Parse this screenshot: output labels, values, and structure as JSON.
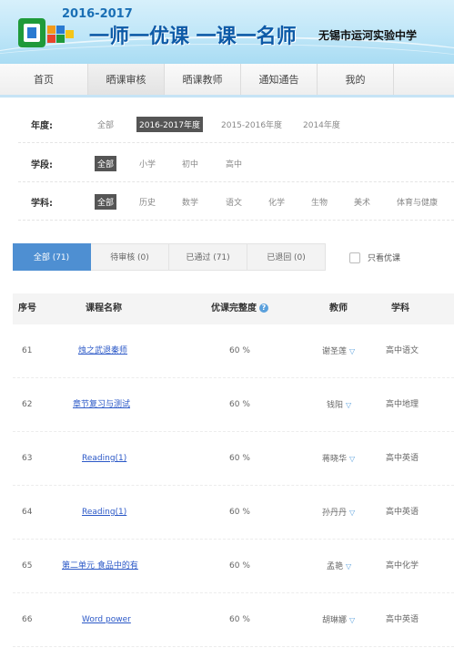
{
  "banner": {
    "year": "2016-2017",
    "slogan": "一师一优课 一课一名师",
    "school": "无锡市运河实验中学"
  },
  "nav": {
    "items": [
      {
        "label": "首页",
        "active": false
      },
      {
        "label": "晒课审核",
        "active": true
      },
      {
        "label": "晒课教师",
        "active": false
      },
      {
        "label": "通知通告",
        "active": false
      },
      {
        "label": "我的",
        "active": false
      }
    ]
  },
  "filters": {
    "year": {
      "label": "年度:",
      "options": [
        "全部",
        "2016-2017年度",
        "2015-2016年度",
        "2014年度"
      ],
      "selected": "2016-2017年度"
    },
    "level": {
      "label": "学段:",
      "options": [
        "全部",
        "小学",
        "初中",
        "高中"
      ],
      "selected": "全部"
    },
    "subject": {
      "label": "学科:",
      "options": [
        "全部",
        "历史",
        "数学",
        "语文",
        "化学",
        "生物",
        "美术",
        "体育与健康"
      ],
      "selected": "全部"
    }
  },
  "tabs": [
    {
      "label": "全部 (71)",
      "active": true
    },
    {
      "label": "待审核 (0)",
      "active": false
    },
    {
      "label": "已通过 (71)",
      "active": false
    },
    {
      "label": "已退回 (0)",
      "active": false
    }
  ],
  "only_good": {
    "label": "只看优课",
    "checked": false
  },
  "table": {
    "headers": {
      "seq": "序号",
      "course": "课程名称",
      "completeness": "优课完整度",
      "teacher": "教师",
      "subject": "学科"
    },
    "rows": [
      {
        "seq": "61",
        "course": "烛之武退秦师",
        "completeness": "60 %",
        "teacher": "谢圣莲",
        "subject": "高中语文"
      },
      {
        "seq": "62",
        "course": "章节复习与测试",
        "completeness": "60 %",
        "teacher": "钱阳",
        "subject": "高中地理"
      },
      {
        "seq": "63",
        "course": "Reading(1)",
        "completeness": "60 %",
        "teacher": "蒋晓华",
        "subject": "高中英语"
      },
      {
        "seq": "64",
        "course": "Reading(1)",
        "completeness": "60 %",
        "teacher": "孙丹丹",
        "subject": "高中英语"
      },
      {
        "seq": "65",
        "course": "第二单元 食品中的有",
        "completeness": "60 %",
        "teacher": "孟艳",
        "subject": "高中化学"
      },
      {
        "seq": "66",
        "course": "Word power",
        "completeness": "60 %",
        "teacher": "胡琳娜",
        "subject": "高中英语"
      }
    ]
  },
  "colors": {
    "accent": "#4e8fd2",
    "link": "#2b58c7",
    "banner_text": "#0d5aa7"
  }
}
